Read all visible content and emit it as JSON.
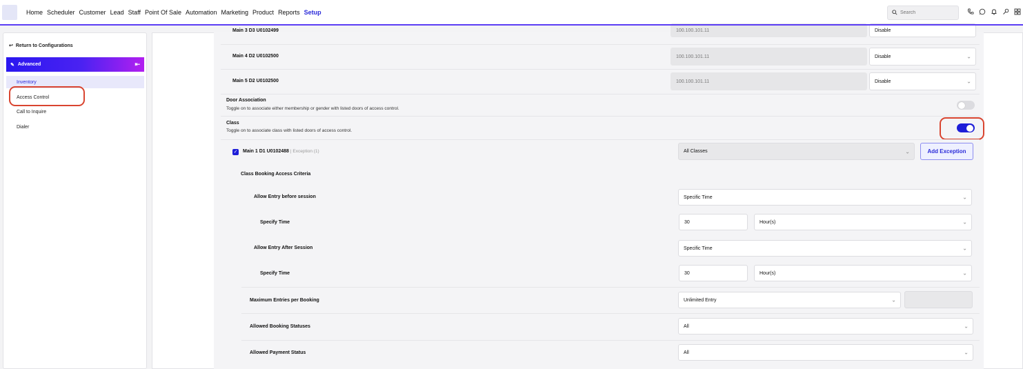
{
  "nav": {
    "items": [
      "Home",
      "Scheduler",
      "Customer",
      "Lead",
      "Staff",
      "Point Of Sale",
      "Automation",
      "Marketing",
      "Product",
      "Reports",
      "Setup"
    ],
    "active": "Setup",
    "search_placeholder": "Search",
    "icons": [
      "phone-icon",
      "whatsapp-icon",
      "bell-icon",
      "key-icon",
      "grid-icon"
    ]
  },
  "sidebar": {
    "return_label": "Return to Configurations",
    "section_label": "Advanced",
    "items": [
      "Inventory",
      "Access Control",
      "Call to Inquire",
      "Dialer"
    ],
    "selected": "Inventory"
  },
  "doors": [
    {
      "name": "Main 3 D3 U0102499",
      "ip": "100.100.101.11",
      "status": "Disable"
    },
    {
      "name": "Main 4 D2 U0102500",
      "ip": "100.100.101.11",
      "status": "Disable"
    },
    {
      "name": "Main 5 D2 U0102500",
      "ip": "100.100.101.11",
      "status": "Disable"
    }
  ],
  "door_association": {
    "title": "Door Association",
    "desc": "Toggle on to associate either membership or gender with listed doors of access control.",
    "enabled": false
  },
  "class": {
    "title": "Class",
    "desc": "Toggle on to associate class with listed doors of access control.",
    "enabled": true
  },
  "class_door": {
    "name": "Main 1 D1 U0102488",
    "exception": "| Exception (1)",
    "checked": true,
    "class_select": "All Classes",
    "add_exception_label": "Add Exception"
  },
  "criteria": {
    "title": "Class Booking Access Criteria",
    "entry_before_label": "Allow Entry before session",
    "entry_before_value": "Specific Time",
    "specify_time_label": "Specify Time",
    "before_time_value": "30",
    "before_time_unit": "Hour(s)",
    "entry_after_label": "Allow Entry After Session",
    "entry_after_value": "Specific Time",
    "after_time_value": "30",
    "after_time_unit": "Hour(s)",
    "max_entries_label": "Maximum Entries per Booking",
    "max_entries_value": "Unlimited Entry",
    "booking_status_label": "Allowed Booking Statuses",
    "booking_status_value": "All",
    "payment_status_label": "Allowed Payment Status",
    "payment_status_value": "All"
  }
}
